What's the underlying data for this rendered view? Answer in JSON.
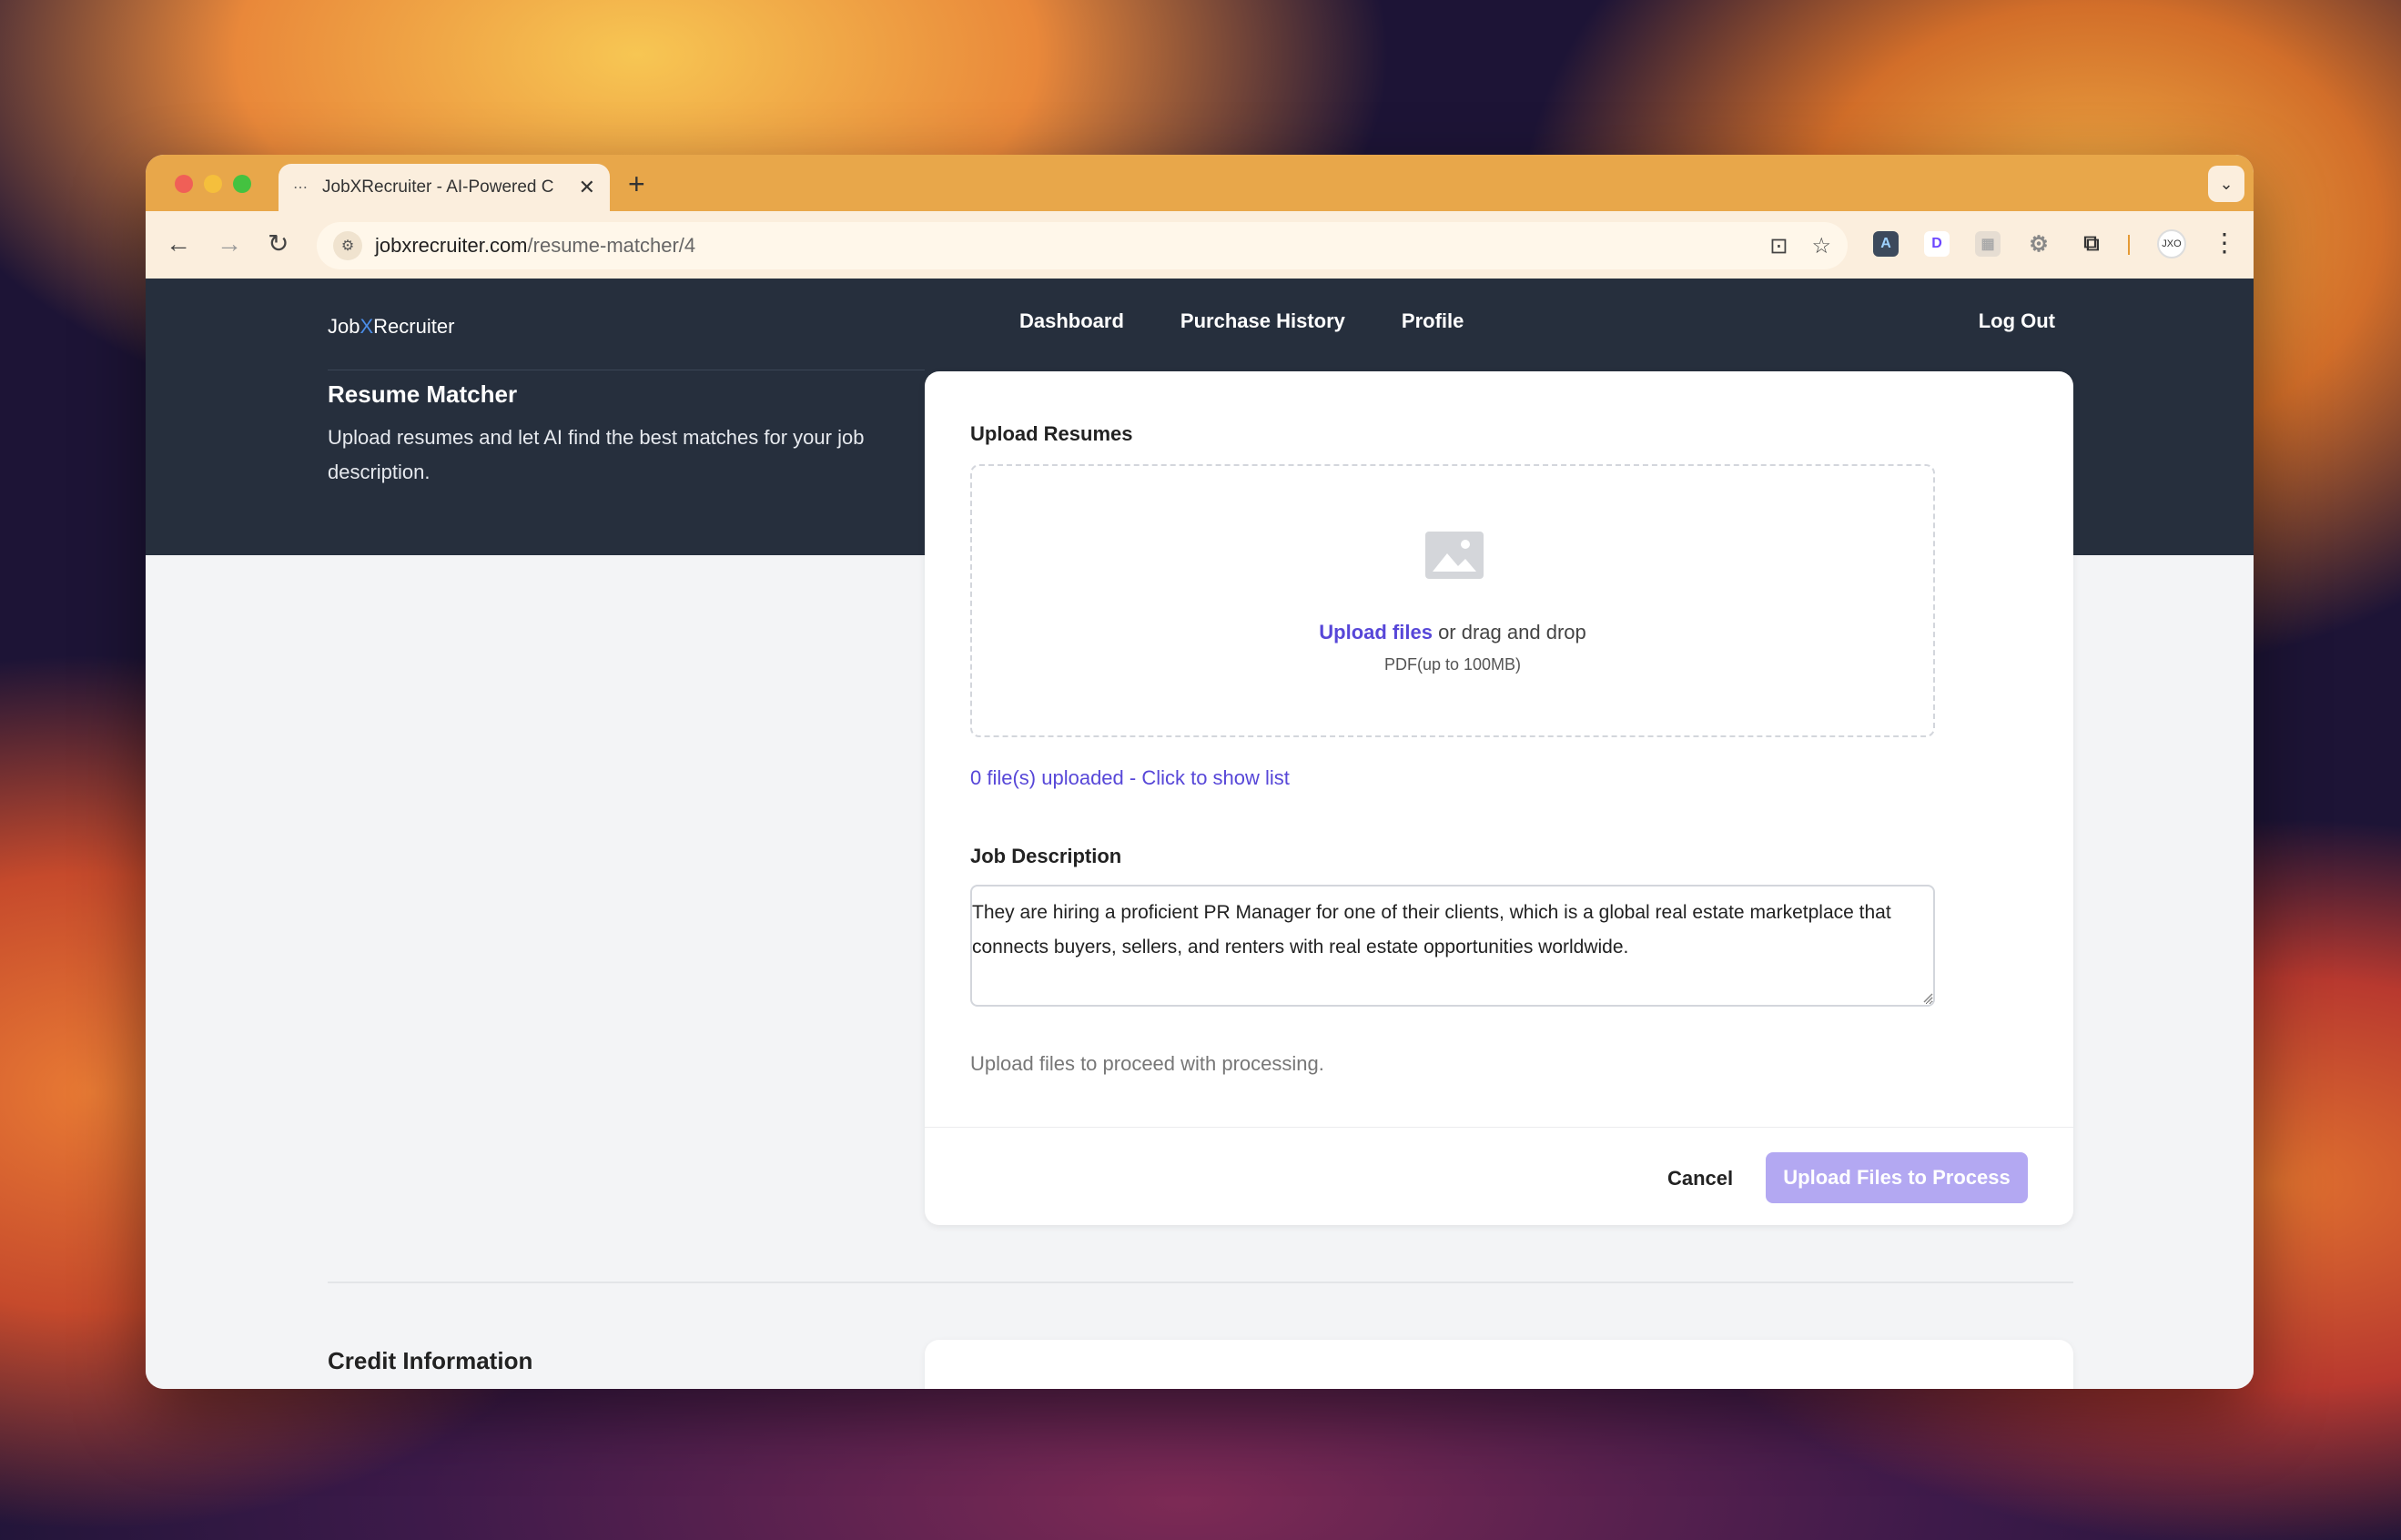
{
  "browser": {
    "tab_title": "JobXRecruiter - AI-Powered C",
    "tab_close": "✕",
    "new_tab": "+",
    "url_host": "jobxrecruiter.com",
    "url_path": "/resume-matcher/4",
    "profile_initials": "JXO"
  },
  "nav": {
    "brand_prefix": "Job",
    "brand_x": "X",
    "brand_suffix": "Recruiter",
    "links": [
      "Dashboard",
      "Purchase History",
      "Profile"
    ],
    "logout": "Log Out"
  },
  "section": {
    "title": "Resume Matcher",
    "description": "Upload resumes and let AI find the best matches for your job description."
  },
  "upload": {
    "label": "Upload Resumes",
    "link_text": "Upload files",
    "drop_text": " or drag and drop",
    "hint": "PDF(up to 100MB)",
    "files_status": "0 file(s) uploaded - Click to show list"
  },
  "job": {
    "label": "Job Description",
    "value": "They are hiring a proficient PR Manager for one of their clients, which is a global real estate marketplace that connects buyers, sellers, and renters with real estate opportunities worldwide."
  },
  "status_note": "Upload files to proceed with processing.",
  "actions": {
    "cancel": "Cancel",
    "process": "Upload Files to Process"
  },
  "credit": {
    "title": "Credit Information"
  },
  "colors": {
    "accent": "#5747d8",
    "hero_bg": "#262f3d",
    "button_disabled": "#b3a8f2"
  }
}
